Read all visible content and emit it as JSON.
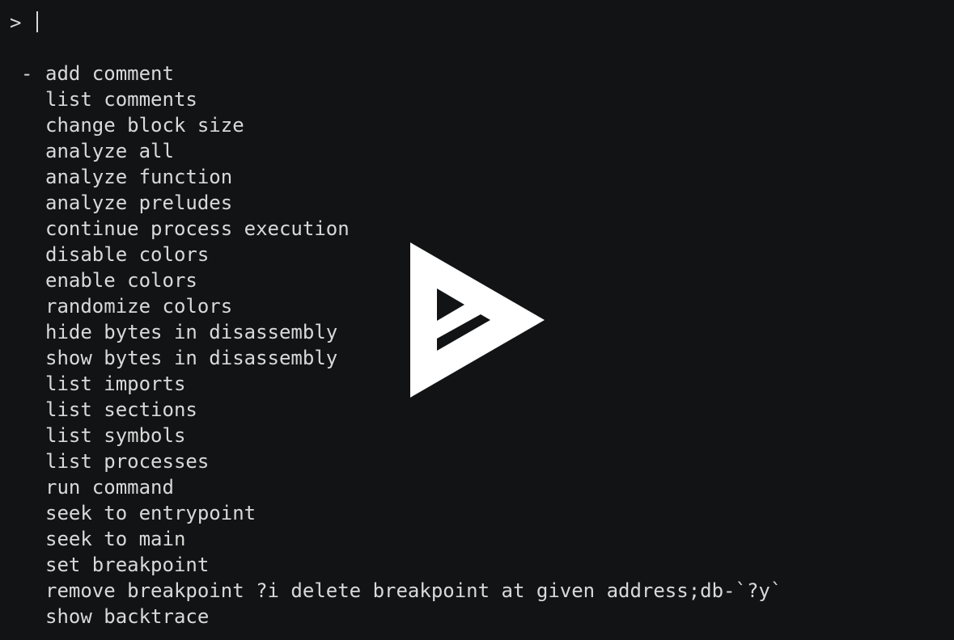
{
  "prompt": {
    "symbol": ">"
  },
  "menu": {
    "marker": "-",
    "items": [
      {
        "label": "add comment",
        "selected": true
      },
      {
        "label": "list comments",
        "selected": false
      },
      {
        "label": "change block size",
        "selected": false
      },
      {
        "label": "analyze all",
        "selected": false
      },
      {
        "label": "analyze function",
        "selected": false
      },
      {
        "label": "analyze preludes",
        "selected": false
      },
      {
        "label": "continue process execution",
        "selected": false
      },
      {
        "label": "disable colors",
        "selected": false
      },
      {
        "label": "enable colors",
        "selected": false
      },
      {
        "label": "randomize colors",
        "selected": false
      },
      {
        "label": "hide bytes in disassembly",
        "selected": false
      },
      {
        "label": "show bytes in disassembly",
        "selected": false
      },
      {
        "label": "list imports",
        "selected": false
      },
      {
        "label": "list sections",
        "selected": false
      },
      {
        "label": "list symbols",
        "selected": false
      },
      {
        "label": "list processes",
        "selected": false
      },
      {
        "label": "run command",
        "selected": false
      },
      {
        "label": "seek to entrypoint",
        "selected": false
      },
      {
        "label": "seek to main",
        "selected": false
      },
      {
        "label": "set breakpoint",
        "selected": false
      },
      {
        "label": "remove breakpoint ?i delete breakpoint at given address;db-`?y`",
        "selected": false
      },
      {
        "label": "show backtrace",
        "selected": false
      }
    ]
  },
  "overlay": {
    "icon": "asciinema-play-icon",
    "color": "#ffffff"
  },
  "colors": {
    "background": "#121314",
    "foreground": "#d9d9d9"
  }
}
